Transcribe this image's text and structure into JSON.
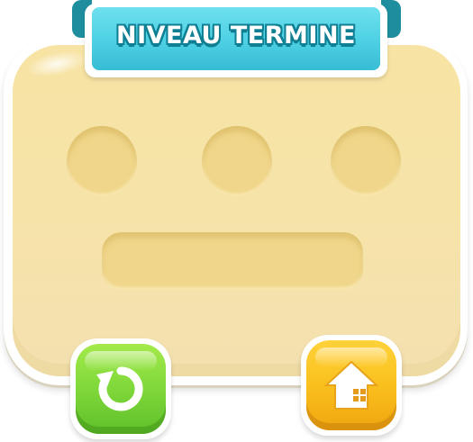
{
  "dialog": {
    "title": "NIVEAU TERMINE"
  },
  "colors": {
    "panel": "#f7e3a3",
    "slot": "#f0d68a",
    "ribbon": "#4dd0e4",
    "replay_button": "#7fd83a",
    "home_button": "#f9c01d"
  },
  "stars": [
    {
      "filled": false
    },
    {
      "filled": false
    },
    {
      "filled": false
    }
  ],
  "buttons": {
    "replay_icon": "replay-icon",
    "home_icon": "home-icon"
  }
}
